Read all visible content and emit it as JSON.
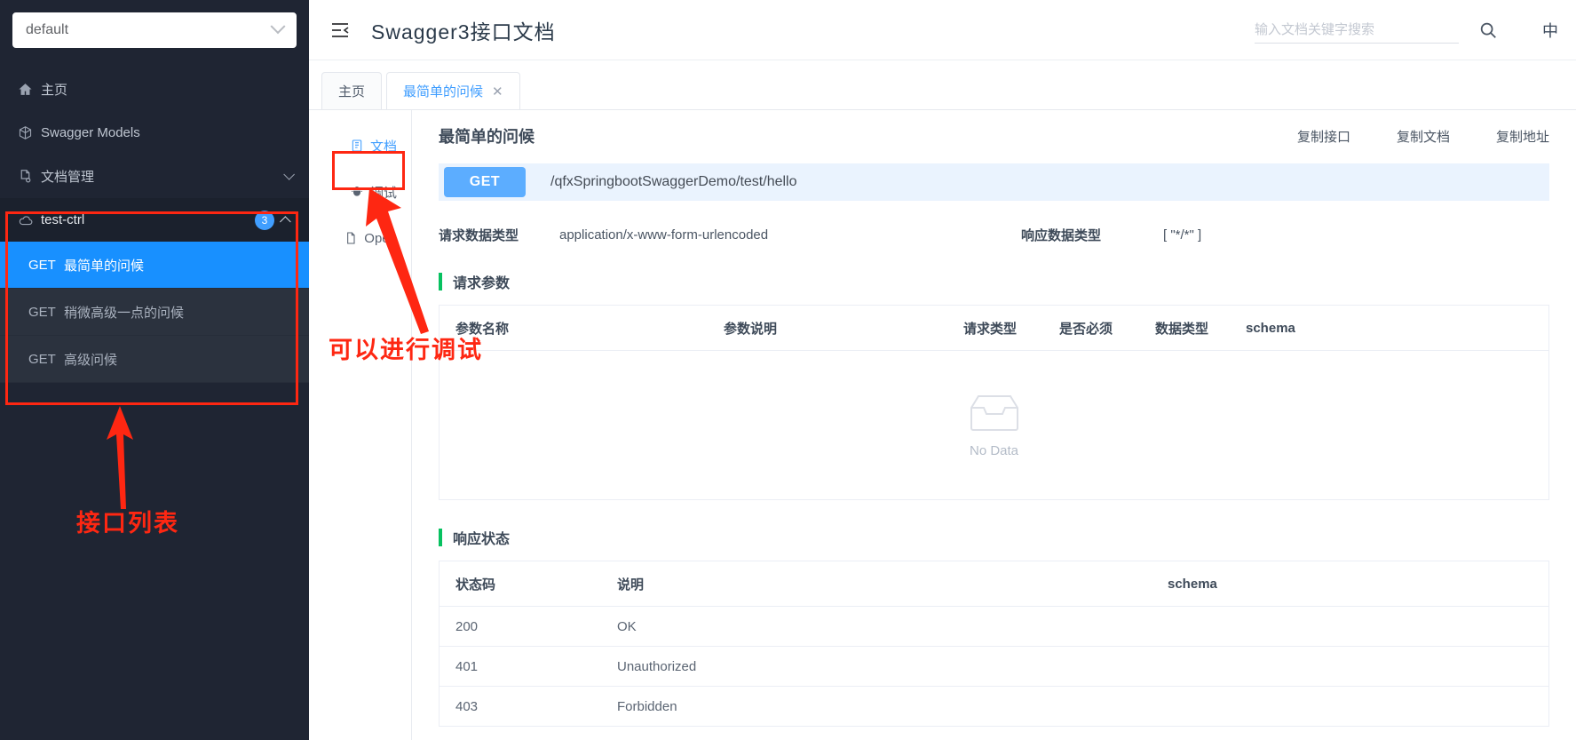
{
  "sidebar": {
    "project_select": {
      "value": "default",
      "icon": "chevron-down-icon"
    },
    "nav": [
      {
        "label": "主页",
        "icon": "home-icon"
      },
      {
        "label": "Swagger Models",
        "icon": "cube-icon"
      },
      {
        "label": "文档管理",
        "icon": "doc-settings-icon",
        "expandable": true
      }
    ],
    "group": {
      "label": "test-ctrl",
      "icon": "cloud-icon",
      "badge": "3",
      "expanded": true
    },
    "apis": [
      {
        "method": "GET",
        "name": "最简单的问候",
        "active": true
      },
      {
        "method": "GET",
        "name": "稍微高级一点的问候",
        "active": false
      },
      {
        "method": "GET",
        "name": "高级问候",
        "active": false
      }
    ],
    "annotation_list": "接口列表"
  },
  "header": {
    "collapse_icon": "menu-fold-icon",
    "title": "Swagger3接口文档",
    "search": {
      "placeholder": "输入文档关键字搜索",
      "value": ""
    },
    "search_icon": "search-icon",
    "lang_toggle": "中"
  },
  "tabs": [
    {
      "label": "主页",
      "active": false,
      "closable": false
    },
    {
      "label": "最简单的问候",
      "active": true,
      "closable": true,
      "close_icon": "close-icon"
    }
  ],
  "vtabs": [
    {
      "label": "文档",
      "icon": "document-icon",
      "active": true
    },
    {
      "label": "调试",
      "icon": "bug-icon",
      "active": false,
      "annotated": true
    },
    {
      "label": "Open",
      "icon": "file-icon",
      "active": false
    }
  ],
  "annotation_debug": "可以进行调试",
  "doc": {
    "title": "最简单的问候",
    "actions": [
      "复制接口",
      "复制文档",
      "复制地址"
    ],
    "endpoint": {
      "method": "GET",
      "url": "/qfxSpringbootSwaggerDemo/test/hello"
    },
    "meta": {
      "request_type_label": "请求数据类型",
      "request_type_value": "application/x-www-form-urlencoded",
      "response_type_label": "响应数据类型",
      "response_type_value": "[ \"*/*\" ]"
    },
    "params_section": {
      "title": "请求参数",
      "columns": [
        "参数名称",
        "参数说明",
        "请求类型",
        "是否必须",
        "数据类型",
        "schema"
      ],
      "rows": [],
      "empty_text": "No Data",
      "empty_icon": "inbox-icon"
    },
    "status_section": {
      "title": "响应状态",
      "columns": [
        "状态码",
        "说明",
        "schema"
      ],
      "rows": [
        {
          "code": "200",
          "desc": "OK",
          "schema": ""
        },
        {
          "code": "401",
          "desc": "Unauthorized",
          "schema": ""
        },
        {
          "code": "403",
          "desc": "Forbidden",
          "schema": ""
        }
      ]
    }
  },
  "colors": {
    "sidebar_bg": "#1f2533",
    "accent": "#409eff",
    "annotation_red": "#fe2712",
    "section_green": "#07c160"
  }
}
